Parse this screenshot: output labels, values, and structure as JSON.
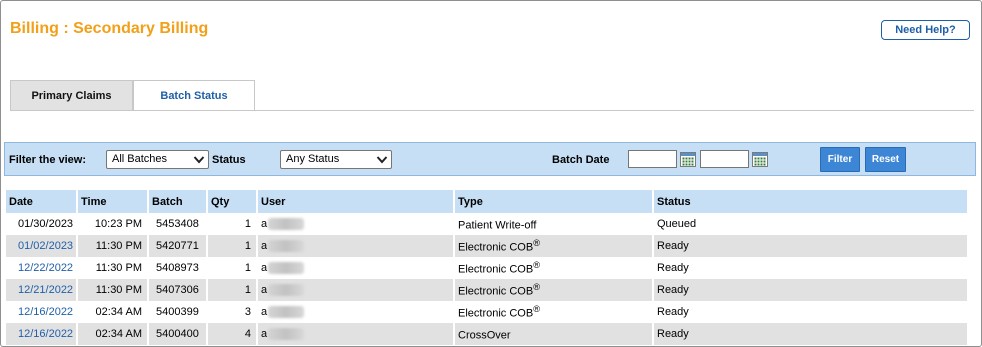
{
  "header": {
    "title": "Billing : Secondary Billing",
    "help_label": "Need Help?"
  },
  "tabs": [
    {
      "label": "Primary Claims",
      "active": false
    },
    {
      "label": "Batch Status",
      "active": true
    }
  ],
  "filter": {
    "view_label": "Filter the view:",
    "batches_value": "All Batches",
    "status_label": "Status",
    "status_value": "Any Status",
    "batch_date_label": "Batch Date",
    "date_from": "",
    "date_to": "",
    "filter_button": "Filter",
    "reset_button": "Reset"
  },
  "table": {
    "columns": [
      "Date",
      "Time",
      "Batch",
      "Qty",
      "User",
      "Type",
      "Status"
    ],
    "rows": [
      {
        "date": "01/30/2023",
        "date_link": false,
        "time": "10:23 PM",
        "batch": "5453408",
        "qty": "1",
        "user_prefix": "a",
        "type": "Patient Write-off",
        "type_sup": "",
        "status": "Queued"
      },
      {
        "date": "01/02/2023",
        "date_link": true,
        "time": "11:30 PM",
        "batch": "5420771",
        "qty": "1",
        "user_prefix": "a",
        "type": "Electronic COB",
        "type_sup": "®",
        "status": "Ready"
      },
      {
        "date": "12/22/2022",
        "date_link": true,
        "time": "11:30 PM",
        "batch": "5408973",
        "qty": "1",
        "user_prefix": "a",
        "type": "Electronic COB",
        "type_sup": "®",
        "status": "Ready"
      },
      {
        "date": "12/21/2022",
        "date_link": true,
        "time": "11:30 PM",
        "batch": "5407306",
        "qty": "1",
        "user_prefix": "a",
        "type": "Electronic COB",
        "type_sup": "®",
        "status": "Ready"
      },
      {
        "date": "12/16/2022",
        "date_link": true,
        "time": "02:34 AM",
        "batch": "5400399",
        "qty": "3",
        "user_prefix": "a",
        "type": "Electronic COB",
        "type_sup": "®",
        "status": "Ready"
      },
      {
        "date": "12/16/2022",
        "date_link": true,
        "time": "02:34 AM",
        "batch": "5400400",
        "qty": "4",
        "user_prefix": "a",
        "type": "CrossOver",
        "type_sup": "",
        "status": "Ready"
      }
    ]
  },
  "colors": {
    "title": "#f2a019",
    "link": "#1f5fa8",
    "header_bg": "#c6dff5",
    "alt_row_bg": "#e1e1e1",
    "button_bg": "#3d86d6"
  },
  "icons": [
    "calendar-icon",
    "chevron-down-icon"
  ]
}
